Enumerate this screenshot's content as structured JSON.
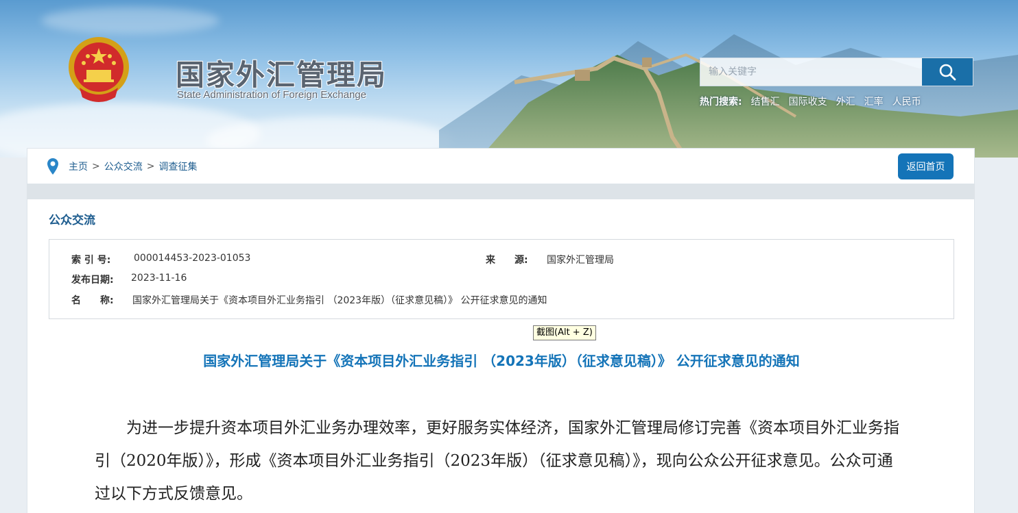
{
  "header": {
    "site_title": "国家外汇管理局",
    "site_subtitle": "State Administration of Foreign Exchange",
    "search": {
      "placeholder": "输入关键字",
      "button_icon": "search-icon"
    },
    "hot_search": {
      "label": "热门搜索:",
      "items": [
        "结售汇",
        "国际收支",
        "外汇",
        "汇率",
        "人民币"
      ]
    }
  },
  "breadcrumb": {
    "icon": "location-pin-icon",
    "items": [
      "主页",
      "公众交流",
      "调查征集"
    ],
    "separator": ">",
    "home_button": "返回首页"
  },
  "main": {
    "section_title": "公众交流",
    "meta": {
      "index_label": "索 引 号:",
      "index_value": "000014453-2023-01053",
      "source_label": "来　　源:",
      "source_value": "国家外汇管理局",
      "date_label": "发布日期:",
      "date_value": "2023-11-16",
      "name_label": "名　　称:",
      "name_value": "国家外汇管理局关于《资本项目外汇业务指引 （2023年版）（征求意见稿）》 公开征求意见的通知"
    },
    "tooltip": "截图(Alt + Z)",
    "doc_title": "国家外汇管理局关于《资本项目外汇业务指引 （2023年版）（征求意见稿）》 公开征求意见的通知",
    "doc_body": "为进一步提升资本项目外汇业务办理效率，更好服务实体经济，国家外汇管理局修订完善《资本项目外汇业务指引（2020年版）》，形成《资本项目外汇业务指引（2023年版）（征求意见稿）》，现向公众公开征求意见。公众可通过以下方式反馈意见。"
  },
  "colors": {
    "brand_blue": "#1474b8",
    "link_blue": "#1e5d8f",
    "search_button": "#1a6fa8"
  }
}
